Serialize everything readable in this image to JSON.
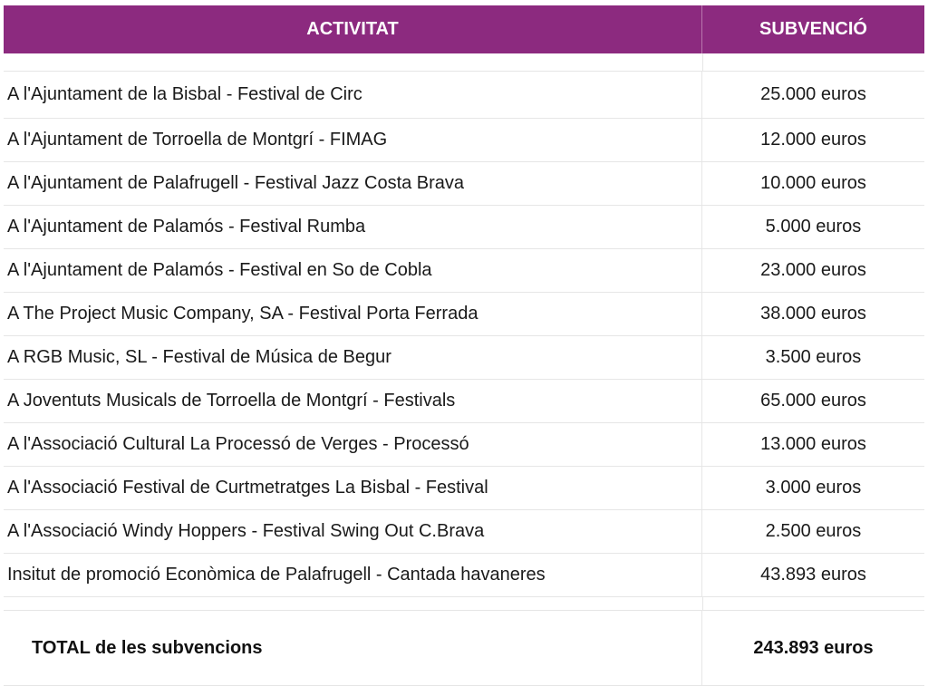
{
  "table": {
    "header": {
      "activity": "ACTIVITAT",
      "subsidy": "SUBVENCIÓ"
    },
    "rows": [
      {
        "activity": "A l'Ajuntament de la Bisbal - Festival de Circ",
        "subsidy": "25.000 euros"
      },
      {
        "activity": "A l'Ajuntament de Torroella de Montgrí - FIMAG",
        "subsidy": "12.000 euros"
      },
      {
        "activity": "A l'Ajuntament de Palafrugell - Festival Jazz Costa Brava",
        "subsidy": "10.000 euros"
      },
      {
        "activity": "A l'Ajuntament de Palamós - Festival Rumba",
        "subsidy": "5.000 euros"
      },
      {
        "activity": "A l'Ajuntament de Palamós - Festival en So de Cobla",
        "subsidy": "23.000 euros"
      },
      {
        "activity": "A The Project Music Company, SA - Festival Porta Ferrada",
        "subsidy": "38.000 euros"
      },
      {
        "activity": "A RGB Music, SL - Festival de Música de Begur",
        "subsidy": "3.500 euros"
      },
      {
        "activity": "A Joventuts Musicals de Torroella de Montgrí - Festivals",
        "subsidy": "65.000 euros"
      },
      {
        "activity": "A l'Associació Cultural La Processó de Verges - Processó",
        "subsidy": "13.000 euros"
      },
      {
        "activity": "A l'Associació Festival de Curtmetratges La Bisbal - Festival",
        "subsidy": "3.000 euros"
      },
      {
        "activity": "A l'Associació Windy Hoppers - Festival Swing Out C.Brava",
        "subsidy": "2.500 euros"
      },
      {
        "activity": "Insitut de promoció Econòmica de Palafrugell - Cantada havaneres",
        "subsidy": "43.893 euros"
      }
    ],
    "total": {
      "label": "TOTAL de les subvencions",
      "value": "243.893 euros"
    }
  },
  "colors": {
    "header_bg": "#8c2a7f",
    "header_text": "#ffffff",
    "border": "#e6e6e6"
  }
}
